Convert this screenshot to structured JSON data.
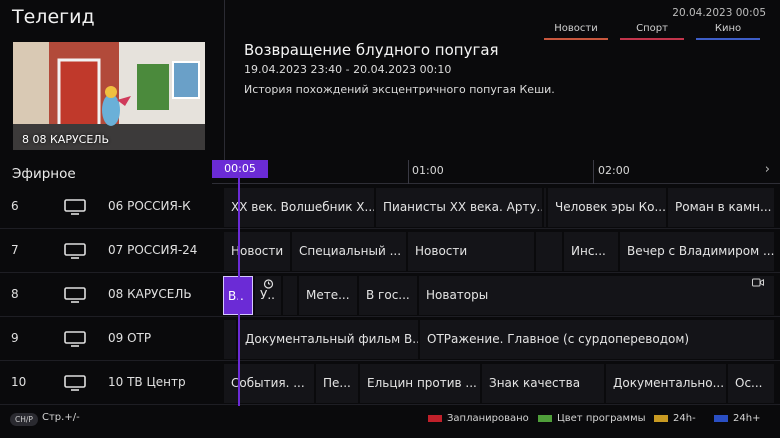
{
  "header": {
    "title": "Телегид",
    "datetime": "20.04.2023 00:05"
  },
  "preview": {
    "channel_label": "8 08 КАРУСЕЛЬ"
  },
  "program": {
    "title": "Возвращение блудного попугая",
    "time": "19.04.2023 23:40 - 20.04.2023 00:10",
    "description": "История похождений эксцентричного попугая Кеши."
  },
  "filters": [
    {
      "label": "Новости",
      "color": "#c8573e"
    },
    {
      "label": "Спорт",
      "color": "#c2354c"
    },
    {
      "label": "Кино",
      "color": "#3e5ec8"
    }
  ],
  "guide": {
    "section_label": "Эфирное",
    "now_label": "00:05",
    "time_marks": [
      "01:00",
      "02:00"
    ],
    "next_icon": "chevron-right-icon"
  },
  "rows": [
    {
      "num": "6",
      "channel": "06 РОССИЯ-К",
      "programs": [
        "ХХ век. Волшебник Х...",
        "Пианисты ХХ века. Арту...",
        "",
        "Человек эры Ко...",
        "Роман в камн..."
      ]
    },
    {
      "num": "7",
      "channel": "07 РОССИЯ-24",
      "programs": [
        "Новости",
        "Специальный ...",
        "Новости",
        "",
        "Инс...",
        "Вечер с Владимиром ..."
      ]
    },
    {
      "num": "8",
      "channel": "08 КАРУСЕЛЬ",
      "programs": [
        "В..",
        "У..",
        "",
        "Мете...",
        "В гос...",
        "Новаторы"
      ]
    },
    {
      "num": "9",
      "channel": "09 ОТР",
      "programs": [
        "",
        "Документальный фильм В...",
        "ОТРажение. Главное (с сурдопереводом)"
      ]
    },
    {
      "num": "10",
      "channel": "10 ТВ Центр",
      "programs": [
        "События. ...",
        "Пе...",
        "Ельцин против ...",
        "Знак качества",
        "Документально...",
        "Ос..."
      ]
    }
  ],
  "footer": {
    "chip": "CH/P",
    "page_label": "Стр.+/-",
    "legend": [
      {
        "label": "Запланировано",
        "color": "#c0202a"
      },
      {
        "label": "Цвет программы",
        "color": "#4f9e3a"
      },
      {
        "label": "24h-",
        "color": "#c89a22"
      },
      {
        "label": "24h+",
        "color": "#2a4fc4"
      }
    ]
  }
}
